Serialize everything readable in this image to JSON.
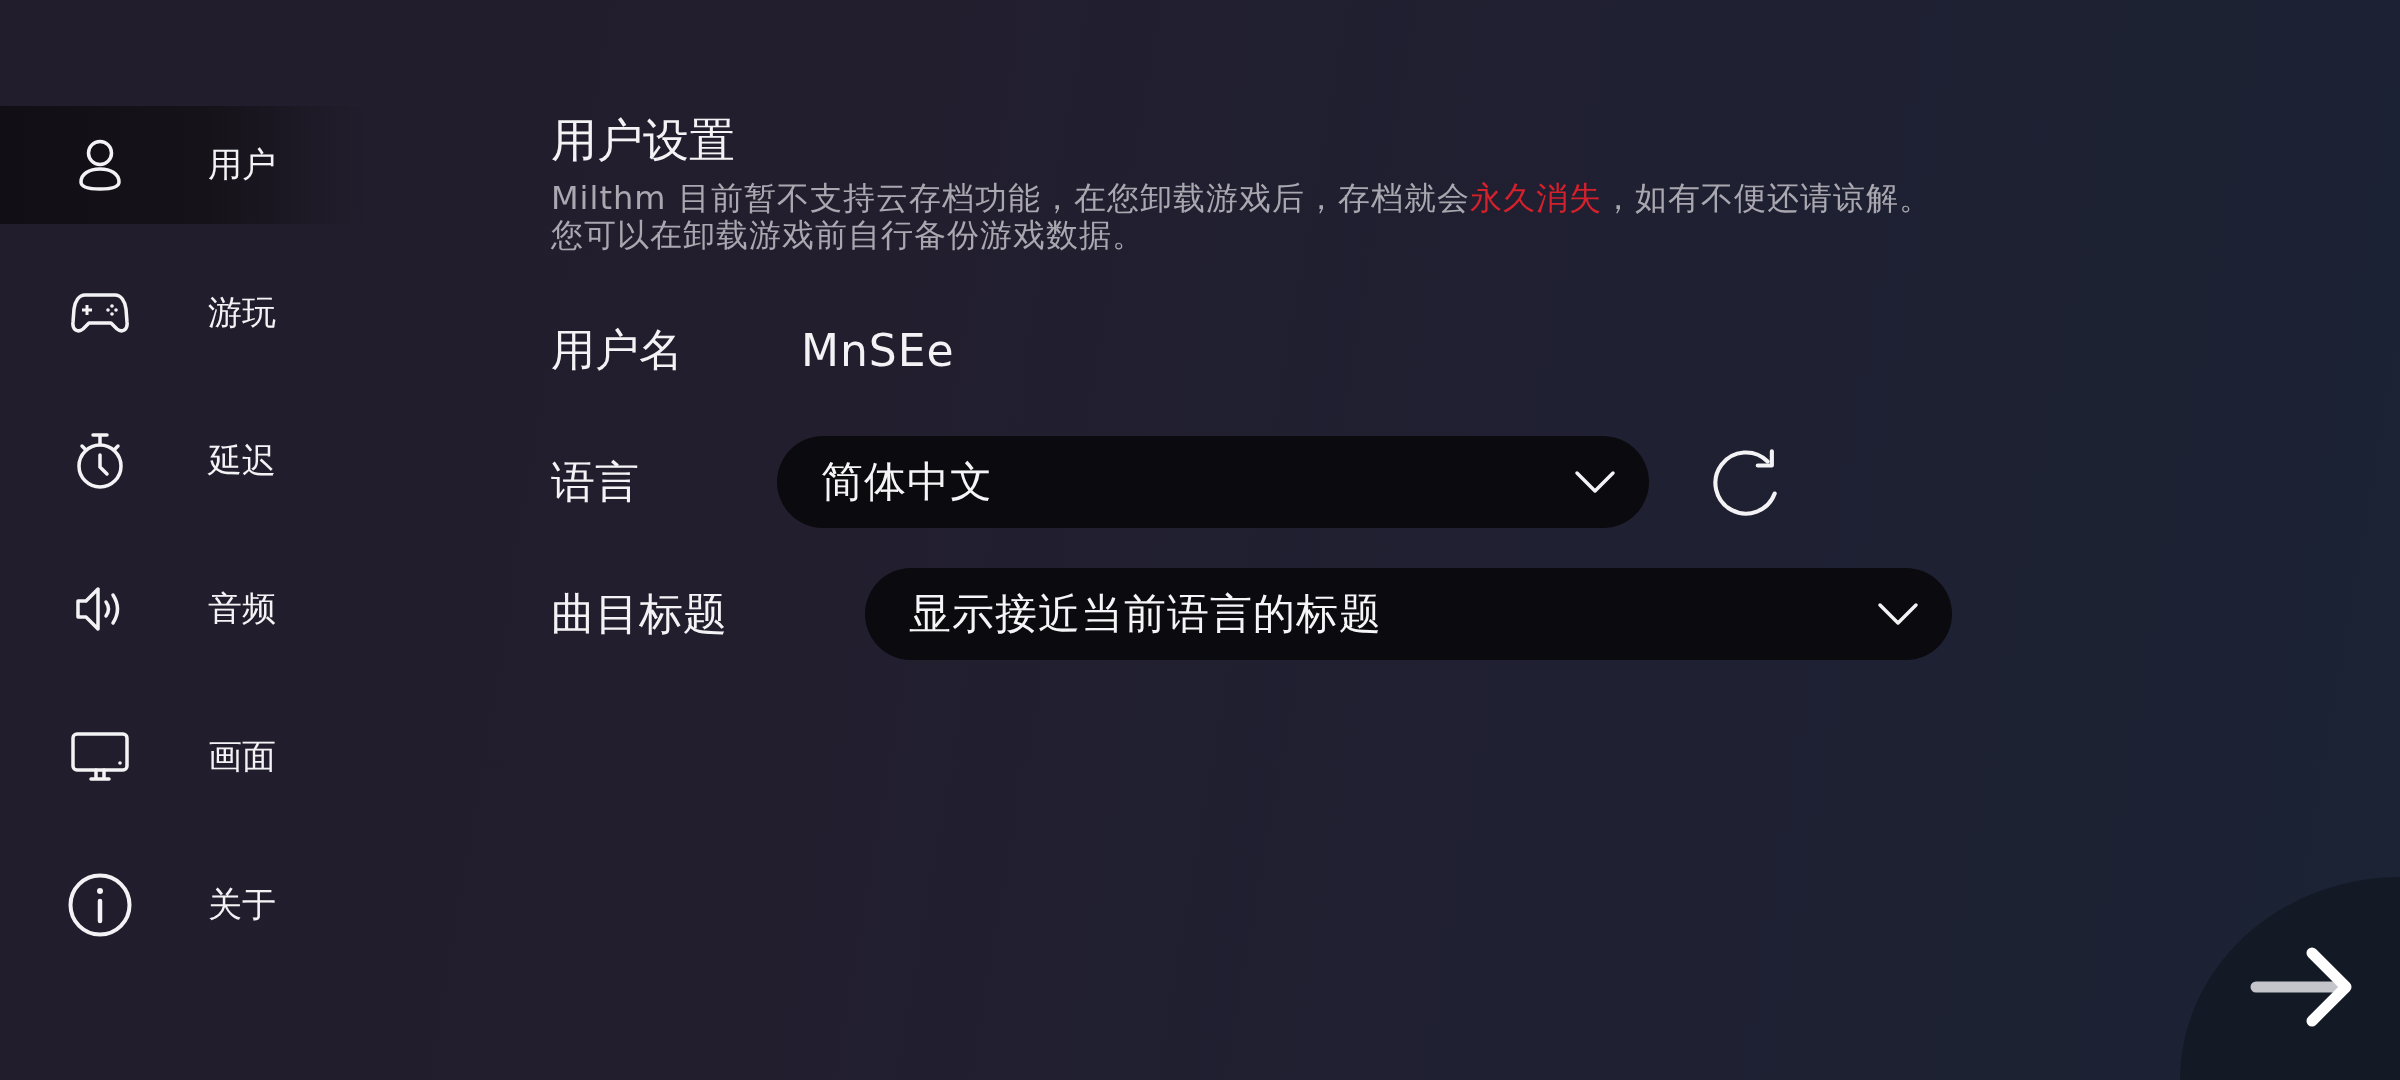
{
  "sidebar": {
    "items": [
      {
        "label": "用户",
        "selected": true
      },
      {
        "label": "游玩",
        "selected": false
      },
      {
        "label": "延迟",
        "selected": false
      },
      {
        "label": "音频",
        "selected": false
      },
      {
        "label": "画面",
        "selected": false
      },
      {
        "label": "关于",
        "selected": false
      }
    ]
  },
  "settings": {
    "title": "用户设置",
    "notice": [
      {
        "parts": [
          {
            "text": "Milthm 目前暂不支持云存档功能，在您卸载游戏后，存档就会",
            "highlight": false
          },
          {
            "text": "永久消失",
            "highlight": true
          },
          {
            "text": "，如有不便还请谅解。",
            "highlight": false
          }
        ]
      },
      {
        "parts": [
          {
            "text": "您可以在卸载游戏前自行备份游戏数据。",
            "highlight": false
          }
        ]
      }
    ],
    "rows": [
      {
        "kind": "text",
        "label": "用户名",
        "value": "MnSEe"
      },
      {
        "kind": "dropdown",
        "label": "语言",
        "value": "简体中文",
        "refresh_button": true
      },
      {
        "kind": "dropdown",
        "label": "曲目标题",
        "value": "显示接近当前语言的标题",
        "refresh_button": false
      }
    ]
  }
}
